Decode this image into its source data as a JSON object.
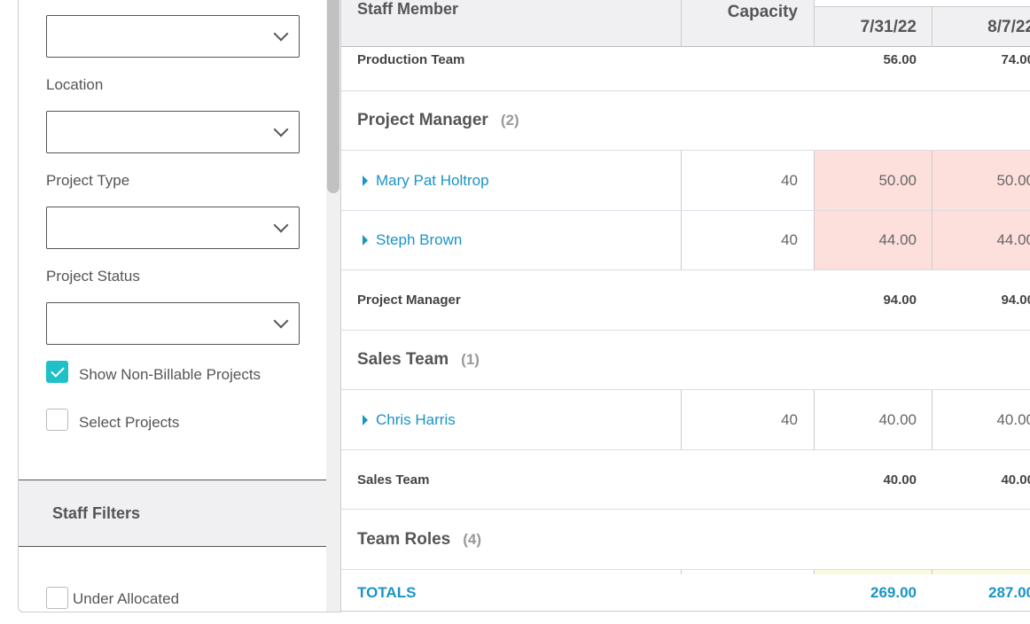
{
  "filters": {
    "location_label": "Location",
    "project_type_label": "Project Type",
    "project_status_label": "Project Status",
    "show_non_billable": {
      "label": "Show Non-Billable Projects",
      "checked": true
    },
    "select_projects": {
      "label": "Select Projects",
      "checked": false
    },
    "staff_filters_title": "Staff Filters",
    "under_allocated": {
      "label": "Under Allocated",
      "checked": false
    }
  },
  "table": {
    "headers": {
      "staff": "Staff Member",
      "capacity": "Capacity",
      "dates": [
        "7/31/22",
        "8/7/22"
      ]
    },
    "production_subtotal": {
      "label": "Production Team",
      "values": [
        "56.00",
        "74.00"
      ]
    },
    "groups": [
      {
        "name": "Project Manager",
        "count": "(2)",
        "members": [
          {
            "name": "Mary Pat Holtrop",
            "capacity": "40",
            "values": [
              "50.00",
              "50.00"
            ]
          },
          {
            "name": "Steph Brown",
            "capacity": "40",
            "values": [
              "44.00",
              "44.00"
            ]
          }
        ],
        "subtotal": {
          "label": "Project Manager",
          "values": [
            "94.00",
            "94.00"
          ]
        }
      },
      {
        "name": "Sales Team",
        "count": "(1)",
        "members": [
          {
            "name": "Chris Harris",
            "capacity": "40",
            "values": [
              "40.00",
              "40.00"
            ]
          }
        ],
        "subtotal": {
          "label": "Sales Team",
          "values": [
            "40.00",
            "40.00"
          ]
        }
      },
      {
        "name": "Team Roles",
        "count": "(4)"
      }
    ],
    "totals": {
      "label": "TOTALS",
      "values": [
        "269.00",
        "287.00"
      ]
    },
    "colors": {
      "over_allocated": "#fde0dc",
      "link": "#1a94c4",
      "checkbox": "#1fc0c8"
    }
  }
}
